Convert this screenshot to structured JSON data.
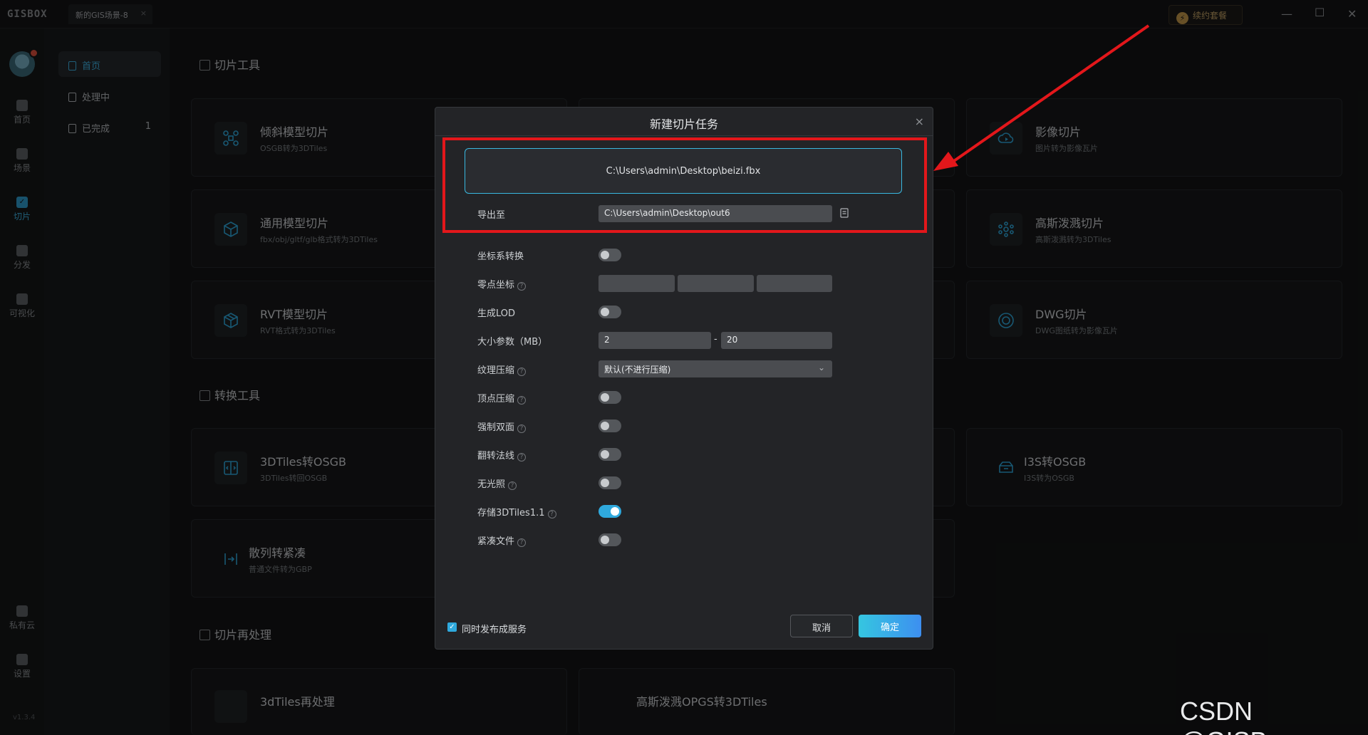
{
  "app": {
    "logo": "GISBOX",
    "tab_label": "新的GIS场景-8",
    "tab_close": "×",
    "renew_label": "续约套餐",
    "version": "v1.3.4"
  },
  "leftnav": {
    "items": [
      {
        "label": "首页",
        "icon": "home-icon"
      },
      {
        "label": "场景",
        "icon": "scene-icon"
      },
      {
        "label": "切片",
        "icon": "slice-icon"
      },
      {
        "label": "分发",
        "icon": "share-icon"
      },
      {
        "label": "可视化",
        "icon": "visual-icon"
      },
      {
        "label": "私有云",
        "icon": "cloud-lock-icon"
      },
      {
        "label": "设置",
        "icon": "gear-icon"
      }
    ]
  },
  "subnav": {
    "items": [
      {
        "label": "首页"
      },
      {
        "label": "处理中"
      },
      {
        "label": "已完成",
        "count": "1"
      }
    ]
  },
  "sections": {
    "slice_tools": "切片工具",
    "convert_tools": "转换工具",
    "reprocess": "切片再处理"
  },
  "cards": {
    "oblique": {
      "title": "倾斜模型切片",
      "sub": "OSGB转为3DTiles"
    },
    "general": {
      "title": "通用模型切片",
      "sub": "fbx/obj/gltf/glb格式转为3DTiles"
    },
    "rvt": {
      "title": "RVT模型切片",
      "sub": "RVT格式转为3DTiles"
    },
    "image": {
      "title": "影像切片",
      "sub": "图片转为影像瓦片"
    },
    "gaussian": {
      "title": "高斯泼溅切片",
      "sub": "高斯泼溅转为3DTiles"
    },
    "dwg": {
      "title": "DWG切片",
      "sub": "DWG图纸转为影像瓦片"
    },
    "tiles_osgb": {
      "title": "3DTiles转OSGB",
      "sub": "3DTiles转回OSGB"
    },
    "i3s_osgb": {
      "title": "I3S转OSGB",
      "sub": "I3S转为OSGB"
    },
    "scatter": {
      "title": "散列转紧凑",
      "sub": "普通文件转为GBP"
    },
    "tiles_reprocess": {
      "title": "3dTiles再处理"
    },
    "gauss_opgs": {
      "title": "高斯泼溅OPGS转3DTiles"
    }
  },
  "dialog": {
    "title": "新建切片任务",
    "close": "×",
    "input_path": "C:\\Users\\admin\\Desktop\\beizi.fbx",
    "export_label": "导出至",
    "export_path": "C:\\Users\\admin\\Desktop\\out6",
    "coord_label": "坐标系转换",
    "zero_label": "零点坐标",
    "lod_label": "生成LOD",
    "size_label": "大小参数（MB）",
    "size_min": "2",
    "size_sep": "-",
    "size_max": "20",
    "texture_label": "纹理压缩",
    "texture_value": "默认(不进行压缩)",
    "vertex_label": "顶点压缩",
    "double_label": "强制双面",
    "flip_label": "翻转法线",
    "nolight_label": "无光照",
    "store_label": "存储3DTiles1.1",
    "compact_label": "紧凑文件",
    "help_mark": "?",
    "publish_label": "同时发布成服务",
    "cancel": "取消",
    "ok": "确定",
    "toggles": {
      "coord": false,
      "lod": false,
      "vertex": false,
      "double": false,
      "flip": false,
      "nolight": false,
      "store": true,
      "compact": false
    }
  },
  "watermark": "CSDN @GISBox",
  "colors": {
    "accent": "#2fa9dd",
    "highlight": "#e3171b"
  }
}
